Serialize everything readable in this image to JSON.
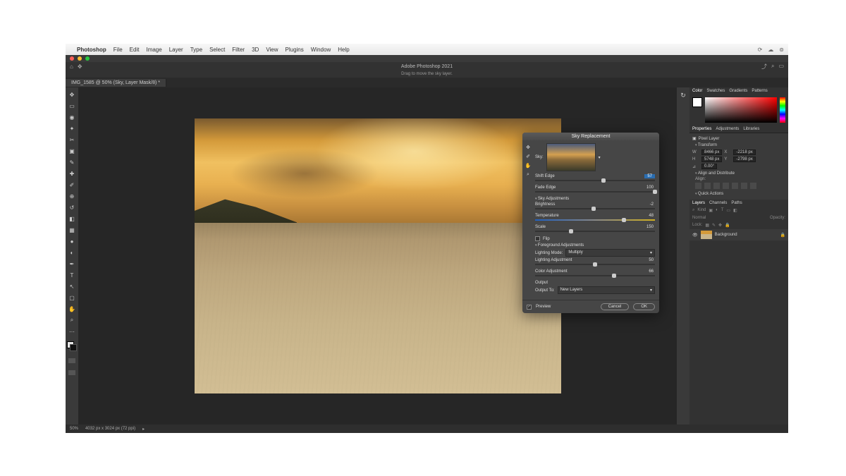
{
  "mac_menu": {
    "app": "Photoshop",
    "items": [
      "File",
      "Edit",
      "Image",
      "Layer",
      "Type",
      "Select",
      "Filter",
      "3D",
      "View",
      "Plugins",
      "Window",
      "Help"
    ]
  },
  "window_title": "Adobe Photoshop 2021",
  "hint": "Drag to move the sky layer.",
  "doc_tab": "IMG_1585 @ 50% (Sky, Layer Mask/8) *",
  "status": {
    "zoom": "50%",
    "dims": "4032 px x 3024 px (72 ppi)"
  },
  "panels": {
    "color_tabs": [
      "Color",
      "Swatches",
      "Gradients",
      "Patterns"
    ],
    "props_tabs": [
      "Properties",
      "Adjustments",
      "Libraries"
    ],
    "pixel_layer": "Pixel Layer",
    "transform": {
      "title": "Transform",
      "w": "8466 px",
      "x": "-2218 px",
      "h": "5748 px",
      "y": "-2798 px",
      "angle": "0.00°"
    },
    "align_title": "Align and Distribute",
    "align_label": "Align:",
    "quick_actions": "Quick Actions",
    "layer_tabs": [
      "Layers",
      "Channels",
      "Paths"
    ],
    "layer_search_placeholder": "Kind",
    "blend": "Normal",
    "opacity_label": "Opacity:",
    "lock_label": "Lock:",
    "bg_layer": "Background"
  },
  "dialog": {
    "title": "Sky Replacement",
    "sky_label": "Sky:",
    "shift_edge": {
      "label": "Shift Edge",
      "value": "57",
      "pos": 57
    },
    "fade_edge": {
      "label": "Fade Edge",
      "value": "100",
      "pos": 100
    },
    "sky_adj": "Sky Adjustments",
    "brightness": {
      "label": "Brightness",
      "value": "-2",
      "pos": 49
    },
    "temperature": {
      "label": "Temperature",
      "value": "48",
      "pos": 74
    },
    "scale": {
      "label": "Scale",
      "value": "150",
      "pos": 30
    },
    "flip": "Flip",
    "fg_adj": "Foreground Adjustments",
    "lighting_mode": {
      "label": "Lighting Mode:",
      "value": "Multiply"
    },
    "lighting_adj": {
      "label": "Lighting Adjustment",
      "value": "50",
      "pos": 50
    },
    "color_adj": {
      "label": "Color Adjustment",
      "value": "66",
      "pos": 66
    },
    "output_header": "Output",
    "output_to": {
      "label": "Output To:",
      "value": "New Layers"
    },
    "preview": "Preview",
    "cancel": "Cancel",
    "ok": "OK"
  }
}
